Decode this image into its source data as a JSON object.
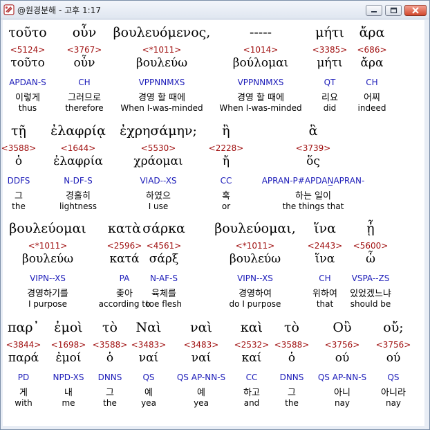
{
  "window": {
    "title": "@원경분해 - 고후 1:17"
  },
  "rows": [
    {
      "words": [
        {
          "greek": "τοῦτο",
          "strong": "<5124>",
          "lemma": "τοῦτο",
          "morph": "APDAN-S",
          "korean": "이렇게",
          "english": "thus"
        },
        {
          "greek": "οὖν",
          "strong": "<3767>",
          "lemma": "οὖν",
          "morph": "CH",
          "korean": "그러므로",
          "english": "therefore"
        },
        {
          "greek": "βουλευόμενος,",
          "strong": "<*1011>",
          "lemma": "βουλεύω",
          "morph": "VPPNNMXS",
          "korean": "경영 할 때에",
          "english": "When I-was-minded"
        },
        {
          "greek": "-----",
          "strong": "<1014>",
          "lemma": "βούλομαι",
          "morph": "VPPNNMXS",
          "korean": "경영 할 때에",
          "english": "When I-was-minded"
        },
        {
          "greek": "μήτι",
          "strong": "<3385>",
          "lemma": "μήτι",
          "morph": "QT",
          "korean": "리요",
          "english": "did"
        },
        {
          "greek": "ἄρα",
          "strong": "<686>",
          "lemma": "ἄρα",
          "morph": "CH",
          "korean": "어찌",
          "english": "indeed"
        }
      ]
    },
    {
      "words": [
        {
          "greek": "τῇ",
          "strong": "<3588>",
          "lemma": "ὁ",
          "morph": "DDFS",
          "korean": "그",
          "english": "the"
        },
        {
          "greek": "ἐλαφρίᾳ",
          "strong": "<1644>",
          "lemma": "ἐλαφρία",
          "morph": "N-DF-S",
          "korean": "경홀히",
          "english": "lightness"
        },
        {
          "greek": "ἐχρησάμην;",
          "strong": "<5530>",
          "lemma": "χράομαι",
          "morph": "VIAD--XS",
          "korean": "하였으",
          "english": "I use"
        },
        {
          "greek": "ἢ",
          "strong": "<2228>",
          "lemma": "ἤ",
          "morph": "CC",
          "korean": "혹",
          "english": "or"
        },
        {
          "greek": "ἃ",
          "strong": "<3739>",
          "lemma": "ὅς",
          "morph": "APRAN-P#APDAN̲APRAN-",
          "korean": "하는 일이",
          "english": "the things that"
        }
      ]
    },
    {
      "words": [
        {
          "greek": "βουλεύομαι",
          "strong": "<*1011>",
          "lemma": "βουλεύω",
          "morph": "VIPN--XS",
          "korean": "경영하기를",
          "english": "I purpose"
        },
        {
          "greek": "κατὰ",
          "strong": "<2596>",
          "lemma": "κατά",
          "morph": "PA",
          "korean": "좇아",
          "english": "according to"
        },
        {
          "greek": "σάρκα",
          "strong": "<4561>",
          "lemma": "σάρξ",
          "morph": "N-AF-S",
          "korean": "육체를",
          "english": "toe flesh"
        },
        {
          "greek": "βουλεύομαι,",
          "strong": "<*1011>",
          "lemma": "βουλεύω",
          "morph": "VIPN--XS",
          "korean": "경영하여",
          "english": "do I purpose"
        },
        {
          "greek": "ἵνα",
          "strong": "<2443>",
          "lemma": "ἵνα",
          "morph": "CH",
          "korean": "위하여",
          "english": "that"
        },
        {
          "greek": "ᾖ",
          "strong": "<5600>",
          "lemma": "ὦ",
          "morph": "VSPA--ZS",
          "korean": "있었겠느냐",
          "english": "should be"
        }
      ]
    },
    {
      "words": [
        {
          "greek": "παρ᾽",
          "strong": "<3844>",
          "lemma": "παρά",
          "morph": "PD",
          "korean": "게",
          "english": "with"
        },
        {
          "greek": "ἐμοὶ",
          "strong": "<1698>",
          "lemma": "ἐμοί",
          "morph": "NPD-XS",
          "korean": "내",
          "english": "me"
        },
        {
          "greek": "τὸ",
          "strong": "<3588>",
          "lemma": "ὁ",
          "morph": "DNNS",
          "korean": "그",
          "english": "the"
        },
        {
          "greek": "Ναὶ",
          "strong": "<3483>",
          "lemma": "ναί",
          "morph": "QS",
          "korean": "예",
          "english": "yea"
        },
        {
          "greek": "ναὶ",
          "strong": "<3483>",
          "lemma": "ναί",
          "morph": "QS AP-NN-S",
          "korean": "예",
          "english": "yea"
        },
        {
          "greek": "καὶ",
          "strong": "<2532>",
          "lemma": "καί",
          "morph": "CC",
          "korean": "하고",
          "english": "and"
        },
        {
          "greek": "τὸ",
          "strong": "<3588>",
          "lemma": "ὁ",
          "morph": "DNNS",
          "korean": "그",
          "english": "the"
        },
        {
          "greek": "Οὒ",
          "strong": "<3756>",
          "lemma": "ού",
          "morph": "QS AP-NN-S",
          "korean": "아니",
          "english": "nay"
        },
        {
          "greek": "οὔ;",
          "strong": "<3756>",
          "lemma": "ού",
          "morph": "QS",
          "korean": "아니라",
          "english": "nay"
        }
      ]
    }
  ]
}
